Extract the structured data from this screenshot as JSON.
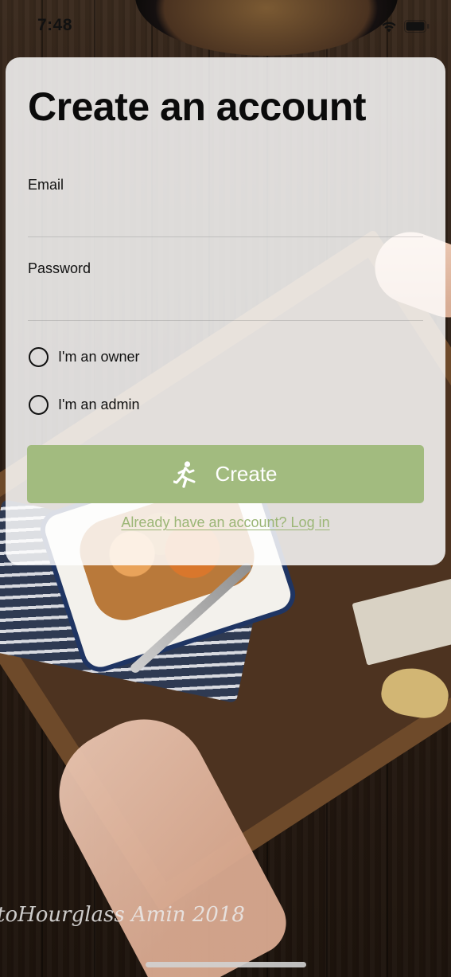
{
  "status_bar": {
    "time": "7:48"
  },
  "form": {
    "title": "Create an account",
    "email": {
      "label": "Email",
      "value": "",
      "placeholder": ""
    },
    "password": {
      "label": "Password",
      "value": "",
      "placeholder": ""
    },
    "radios": [
      {
        "label": "I'm an owner",
        "selected": false
      },
      {
        "label": "I'm an admin",
        "selected": false
      }
    ],
    "create_button": {
      "label": "Create",
      "icon": "runner-icon"
    },
    "login_link": "Already have an account? Log in"
  },
  "background": {
    "watermark": "toHourglass Amin 2018"
  },
  "colors": {
    "button": "#a2bb7f",
    "link": "#9bb676",
    "card": "rgba(255,255,255,0.84)"
  }
}
